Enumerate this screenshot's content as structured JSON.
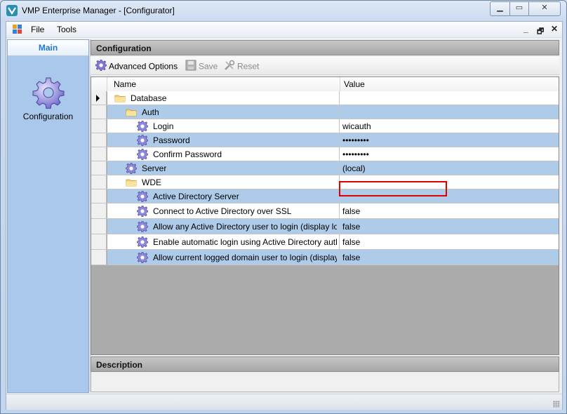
{
  "window": {
    "title": "VMP Enterprise Manager - [Configurator]",
    "min_glyph": "▁",
    "max_glyph": "▭",
    "close_glyph": "✕"
  },
  "menubar": {
    "items": [
      "File",
      "Tools"
    ],
    "mdi_min": "_",
    "mdi_restore": "🗗",
    "mdi_close": "✕"
  },
  "sidebar": {
    "header": "Main",
    "item_label": "Configuration"
  },
  "configuration": {
    "header": "Configuration",
    "toolbar": {
      "advanced": "Advanced Options",
      "save": "Save",
      "reset": "Reset"
    },
    "grid": {
      "columns": {
        "name": "Name",
        "value": "Value"
      },
      "rows": [
        {
          "name": "Database",
          "value": "",
          "type": "folder",
          "level": 0,
          "style": "white",
          "current": true
        },
        {
          "name": "Auth",
          "value": "",
          "type": "folder",
          "level": 1,
          "style": "blue"
        },
        {
          "name": "Login",
          "value": "wicauth",
          "type": "setting",
          "level": 2,
          "style": "white"
        },
        {
          "name": "Password",
          "value": "•••••••••",
          "type": "setting",
          "level": 2,
          "style": "blue"
        },
        {
          "name": "Confirm Password",
          "value": "•••••••••",
          "type": "setting",
          "level": 2,
          "style": "white"
        },
        {
          "name": "Server",
          "value": "(local)",
          "type": "setting",
          "level": 1,
          "style": "blue",
          "highlighted": true
        },
        {
          "name": "WDE",
          "value": "",
          "type": "folder",
          "level": 1,
          "style": "white"
        },
        {
          "name": "Active Directory Server",
          "value": "",
          "type": "setting",
          "level": 2,
          "style": "blue"
        },
        {
          "name": "Connect to Active Directory over SSL",
          "value": "false",
          "type": "setting",
          "level": 2,
          "style": "white",
          "tall": true
        },
        {
          "name": "Allow any Active Directory user to login (display lo...",
          "value": "false",
          "type": "setting",
          "level": 2,
          "style": "blue",
          "tall": true
        },
        {
          "name": "Enable automatic login using Active Directory auth...",
          "value": "false",
          "type": "setting",
          "level": 2,
          "style": "white",
          "tall": true
        },
        {
          "name": "Allow current logged domain user to login (display...",
          "value": "false",
          "type": "setting",
          "level": 2,
          "style": "blue",
          "tall": true
        }
      ]
    }
  },
  "description": {
    "header": "Description",
    "text": ""
  },
  "colors": {
    "row_blue": "#aecbea",
    "highlight": "#e00000",
    "nav_bg": "#a9c8ec",
    "accent": "#1f78d1"
  }
}
